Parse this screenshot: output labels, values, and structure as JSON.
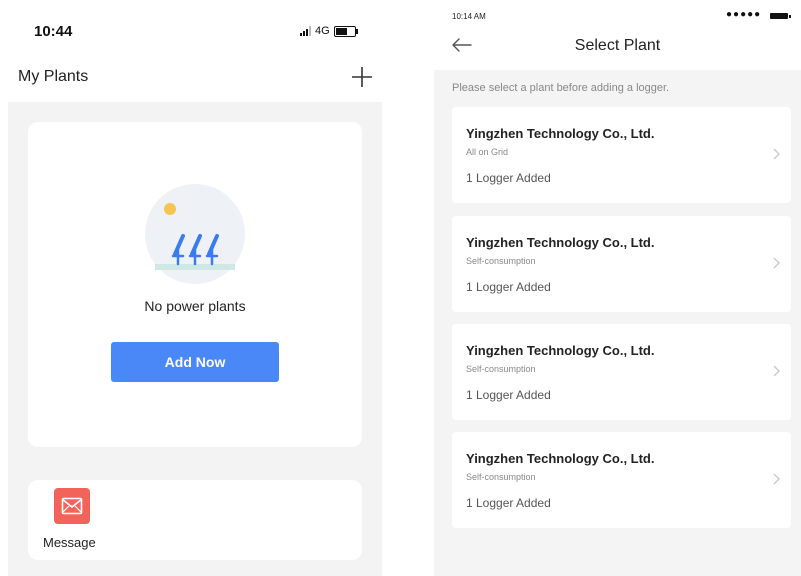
{
  "left_screen": {
    "status_bar": {
      "time": "10:44",
      "network": "4G"
    },
    "header": {
      "title": "My Plants",
      "add_icon": "plus-icon"
    },
    "empty_state": {
      "illustration": "solar-panels-illustration",
      "message": "No power plants",
      "button_label": "Add Now"
    },
    "message_tile": {
      "icon": "envelope-icon",
      "label": "Message"
    },
    "colors": {
      "accent": "#4a87f7",
      "message_icon_bg": "#f2645a",
      "background": "#f3f3f3"
    }
  },
  "right_screen": {
    "status_bar": {
      "time": "10:14 AM",
      "signal": "●●●●●"
    },
    "header": {
      "title": "Select Plant",
      "back_icon": "arrow-left-icon"
    },
    "hint": "Please select a plant before adding a logger.",
    "plants": [
      {
        "name": "Yingzhen Technology Co., Ltd.",
        "type": "All on Grid",
        "loggers": "1 Logger Added"
      },
      {
        "name": "Yingzhen Technology Co., Ltd.",
        "type": "Self-consumption",
        "loggers": "1 Logger Added"
      },
      {
        "name": "Yingzhen Technology Co., Ltd.",
        "type": "Self-consumption",
        "loggers": "1 Logger Added"
      },
      {
        "name": "Yingzhen Technology Co., Ltd.",
        "type": "Self-consumption",
        "loggers": "1 Logger Added"
      }
    ],
    "colors": {
      "background": "#f4f4f4"
    }
  }
}
